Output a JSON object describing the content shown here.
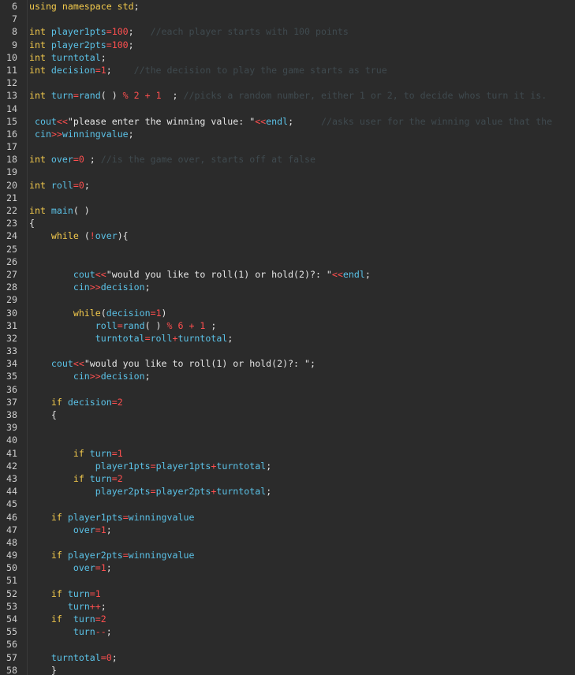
{
  "theme": {
    "background": "#2b2b2b",
    "gutter_text": "#cfcfcf",
    "keyword": "#f2c94c",
    "identifier": "#5bc2e7",
    "number_operator": "#ff4f4f",
    "string": "#e6e6e6",
    "comment": "#3f4a4f"
  },
  "lines": [
    {
      "n": "6",
      "tokens": [
        [
          "kw",
          "using namespace std"
        ],
        [
          "plain",
          ";"
        ]
      ]
    },
    {
      "n": "7",
      "tokens": []
    },
    {
      "n": "8",
      "tokens": [
        [
          "kw",
          "int "
        ],
        [
          "id",
          "player1pts"
        ],
        [
          "op",
          "="
        ],
        [
          "num",
          "100"
        ],
        [
          "plain",
          ";   "
        ],
        [
          "cmt",
          "//each player starts with 100 points"
        ]
      ]
    },
    {
      "n": "9",
      "tokens": [
        [
          "kw",
          "int "
        ],
        [
          "id",
          "player2pts"
        ],
        [
          "op",
          "="
        ],
        [
          "num",
          "100"
        ],
        [
          "plain",
          ";"
        ]
      ]
    },
    {
      "n": "10",
      "tokens": [
        [
          "kw",
          "int "
        ],
        [
          "id",
          "turntotal"
        ],
        [
          "plain",
          ";"
        ]
      ]
    },
    {
      "n": "11",
      "tokens": [
        [
          "kw",
          "int "
        ],
        [
          "id",
          "decision"
        ],
        [
          "op",
          "="
        ],
        [
          "num",
          "1"
        ],
        [
          "plain",
          ";    "
        ],
        [
          "cmt",
          "//the decision to play the game starts as true"
        ]
      ]
    },
    {
      "n": "12",
      "tokens": []
    },
    {
      "n": "13",
      "tokens": [
        [
          "kw",
          "int "
        ],
        [
          "id",
          "turn"
        ],
        [
          "op",
          "="
        ],
        [
          "id",
          "rand"
        ],
        [
          "plain",
          "( ) "
        ],
        [
          "op",
          "% "
        ],
        [
          "num",
          "2 "
        ],
        [
          "op",
          "+ "
        ],
        [
          "num",
          "1  "
        ],
        [
          "plain",
          "; "
        ],
        [
          "cmt",
          "//picks a random number, either 1 or 2, to decide whos turn it is."
        ]
      ]
    },
    {
      "n": "14",
      "tokens": []
    },
    {
      "n": "15",
      "tokens": [
        [
          "plain",
          " "
        ],
        [
          "id",
          "cout"
        ],
        [
          "op",
          "<<"
        ],
        [
          "str",
          "\"please enter the winning value: \""
        ],
        [
          "op",
          "<<"
        ],
        [
          "id",
          "endl"
        ],
        [
          "plain",
          ";     "
        ],
        [
          "cmt",
          "//asks user for the winning value that the"
        ]
      ]
    },
    {
      "n": "16",
      "tokens": [
        [
          "plain",
          " "
        ],
        [
          "id",
          "cin"
        ],
        [
          "op",
          ">>"
        ],
        [
          "id",
          "winningvalue"
        ],
        [
          "plain",
          ";"
        ]
      ]
    },
    {
      "n": "17",
      "tokens": []
    },
    {
      "n": "18",
      "tokens": [
        [
          "kw",
          "int "
        ],
        [
          "id",
          "over"
        ],
        [
          "op",
          "="
        ],
        [
          "num",
          "0 "
        ],
        [
          "plain",
          "; "
        ],
        [
          "cmt",
          "//is the game over, starts off at false"
        ]
      ]
    },
    {
      "n": "19",
      "tokens": []
    },
    {
      "n": "20",
      "tokens": [
        [
          "kw",
          "int "
        ],
        [
          "id",
          "roll"
        ],
        [
          "op",
          "="
        ],
        [
          "num",
          "0"
        ],
        [
          "plain",
          ";"
        ]
      ]
    },
    {
      "n": "21",
      "tokens": []
    },
    {
      "n": "22",
      "tokens": [
        [
          "kw",
          "int "
        ],
        [
          "id",
          "main"
        ],
        [
          "plain",
          "( )"
        ]
      ]
    },
    {
      "n": "23",
      "tokens": [
        [
          "plain",
          "{"
        ]
      ]
    },
    {
      "n": "24",
      "tokens": [
        [
          "plain",
          "    "
        ],
        [
          "kw",
          "while "
        ],
        [
          "plain",
          "("
        ],
        [
          "op",
          "!"
        ],
        [
          "id",
          "over"
        ],
        [
          "plain",
          "){"
        ]
      ]
    },
    {
      "n": "25",
      "tokens": []
    },
    {
      "n": "26",
      "tokens": []
    },
    {
      "n": "27",
      "tokens": [
        [
          "plain",
          "        "
        ],
        [
          "id",
          "cout"
        ],
        [
          "op",
          "<<"
        ],
        [
          "str",
          "\"would you like to roll(1) or hold(2)?: \""
        ],
        [
          "op",
          "<<"
        ],
        [
          "id",
          "endl"
        ],
        [
          "plain",
          ";"
        ]
      ]
    },
    {
      "n": "28",
      "tokens": [
        [
          "plain",
          "        "
        ],
        [
          "id",
          "cin"
        ],
        [
          "op",
          ">>"
        ],
        [
          "id",
          "decision"
        ],
        [
          "plain",
          ";"
        ]
      ]
    },
    {
      "n": "29",
      "tokens": []
    },
    {
      "n": "30",
      "tokens": [
        [
          "plain",
          "        "
        ],
        [
          "kw",
          "while"
        ],
        [
          "plain",
          "("
        ],
        [
          "id",
          "decision"
        ],
        [
          "op",
          "="
        ],
        [
          "num",
          "1"
        ],
        [
          "plain",
          ")"
        ]
      ]
    },
    {
      "n": "31",
      "tokens": [
        [
          "plain",
          "            "
        ],
        [
          "id",
          "roll"
        ],
        [
          "op",
          "="
        ],
        [
          "id",
          "rand"
        ],
        [
          "plain",
          "( ) "
        ],
        [
          "op",
          "% "
        ],
        [
          "num",
          "6 "
        ],
        [
          "op",
          "+ "
        ],
        [
          "num",
          "1 "
        ],
        [
          "plain",
          ";"
        ]
      ]
    },
    {
      "n": "32",
      "tokens": [
        [
          "plain",
          "            "
        ],
        [
          "id",
          "turntotal"
        ],
        [
          "op",
          "="
        ],
        [
          "id",
          "roll"
        ],
        [
          "op",
          "+"
        ],
        [
          "id",
          "turntotal"
        ],
        [
          "plain",
          ";"
        ]
      ]
    },
    {
      "n": "33",
      "tokens": []
    },
    {
      "n": "34",
      "tokens": [
        [
          "plain",
          "    "
        ],
        [
          "id",
          "cout"
        ],
        [
          "op",
          "<<"
        ],
        [
          "str",
          "\"would you like to roll(1) or hold(2)?: \""
        ],
        [
          "plain",
          ";"
        ]
      ]
    },
    {
      "n": "35",
      "tokens": [
        [
          "plain",
          "        "
        ],
        [
          "id",
          "cin"
        ],
        [
          "op",
          ">>"
        ],
        [
          "id",
          "decision"
        ],
        [
          "plain",
          ";"
        ]
      ]
    },
    {
      "n": "36",
      "tokens": []
    },
    {
      "n": "37",
      "tokens": [
        [
          "plain",
          "    "
        ],
        [
          "kw",
          "if "
        ],
        [
          "id",
          "decision"
        ],
        [
          "op",
          "="
        ],
        [
          "num",
          "2"
        ]
      ]
    },
    {
      "n": "38",
      "tokens": [
        [
          "plain",
          "    {"
        ]
      ]
    },
    {
      "n": "39",
      "tokens": []
    },
    {
      "n": "40",
      "tokens": []
    },
    {
      "n": "41",
      "tokens": [
        [
          "plain",
          "        "
        ],
        [
          "kw",
          "if "
        ],
        [
          "id",
          "turn"
        ],
        [
          "op",
          "="
        ],
        [
          "num",
          "1"
        ]
      ]
    },
    {
      "n": "42",
      "tokens": [
        [
          "plain",
          "            "
        ],
        [
          "id",
          "player1pts"
        ],
        [
          "op",
          "="
        ],
        [
          "id",
          "player1pts"
        ],
        [
          "op",
          "+"
        ],
        [
          "id",
          "turntotal"
        ],
        [
          "plain",
          ";"
        ]
      ]
    },
    {
      "n": "43",
      "tokens": [
        [
          "plain",
          "        "
        ],
        [
          "kw",
          "if "
        ],
        [
          "id",
          "turn"
        ],
        [
          "op",
          "="
        ],
        [
          "num",
          "2"
        ]
      ]
    },
    {
      "n": "44",
      "tokens": [
        [
          "plain",
          "            "
        ],
        [
          "id",
          "player2pts"
        ],
        [
          "op",
          "="
        ],
        [
          "id",
          "player2pts"
        ],
        [
          "op",
          "+"
        ],
        [
          "id",
          "turntotal"
        ],
        [
          "plain",
          ";"
        ]
      ]
    },
    {
      "n": "45",
      "tokens": []
    },
    {
      "n": "46",
      "tokens": [
        [
          "plain",
          "    "
        ],
        [
          "kw",
          "if "
        ],
        [
          "id",
          "player1pts"
        ],
        [
          "op",
          "="
        ],
        [
          "id",
          "winningvalue"
        ]
      ]
    },
    {
      "n": "47",
      "tokens": [
        [
          "plain",
          "        "
        ],
        [
          "id",
          "over"
        ],
        [
          "op",
          "="
        ],
        [
          "num",
          "1"
        ],
        [
          "plain",
          ";"
        ]
      ]
    },
    {
      "n": "48",
      "tokens": []
    },
    {
      "n": "49",
      "tokens": [
        [
          "plain",
          "    "
        ],
        [
          "kw",
          "if "
        ],
        [
          "id",
          "player2pts"
        ],
        [
          "op",
          "="
        ],
        [
          "id",
          "winningvalue"
        ]
      ]
    },
    {
      "n": "50",
      "tokens": [
        [
          "plain",
          "        "
        ],
        [
          "id",
          "over"
        ],
        [
          "op",
          "="
        ],
        [
          "num",
          "1"
        ],
        [
          "plain",
          ";"
        ]
      ]
    },
    {
      "n": "51",
      "tokens": []
    },
    {
      "n": "52",
      "tokens": [
        [
          "plain",
          "    "
        ],
        [
          "kw",
          "if "
        ],
        [
          "id",
          "turn"
        ],
        [
          "op",
          "="
        ],
        [
          "num",
          "1"
        ]
      ]
    },
    {
      "n": "53",
      "tokens": [
        [
          "plain",
          "       "
        ],
        [
          "id",
          "turn"
        ],
        [
          "op",
          "++"
        ],
        [
          "plain",
          ";"
        ]
      ]
    },
    {
      "n": "54",
      "tokens": [
        [
          "plain",
          "    "
        ],
        [
          "kw",
          "if  "
        ],
        [
          "id",
          "turn"
        ],
        [
          "op",
          "="
        ],
        [
          "num",
          "2"
        ]
      ]
    },
    {
      "n": "55",
      "tokens": [
        [
          "plain",
          "        "
        ],
        [
          "id",
          "turn"
        ],
        [
          "op",
          "--"
        ],
        [
          "plain",
          ";"
        ]
      ]
    },
    {
      "n": "56",
      "tokens": []
    },
    {
      "n": "57",
      "tokens": [
        [
          "plain",
          "    "
        ],
        [
          "id",
          "turntotal"
        ],
        [
          "op",
          "="
        ],
        [
          "num",
          "0"
        ],
        [
          "plain",
          ";"
        ]
      ]
    },
    {
      "n": "58",
      "tokens": [
        [
          "plain",
          "    }"
        ]
      ]
    }
  ]
}
